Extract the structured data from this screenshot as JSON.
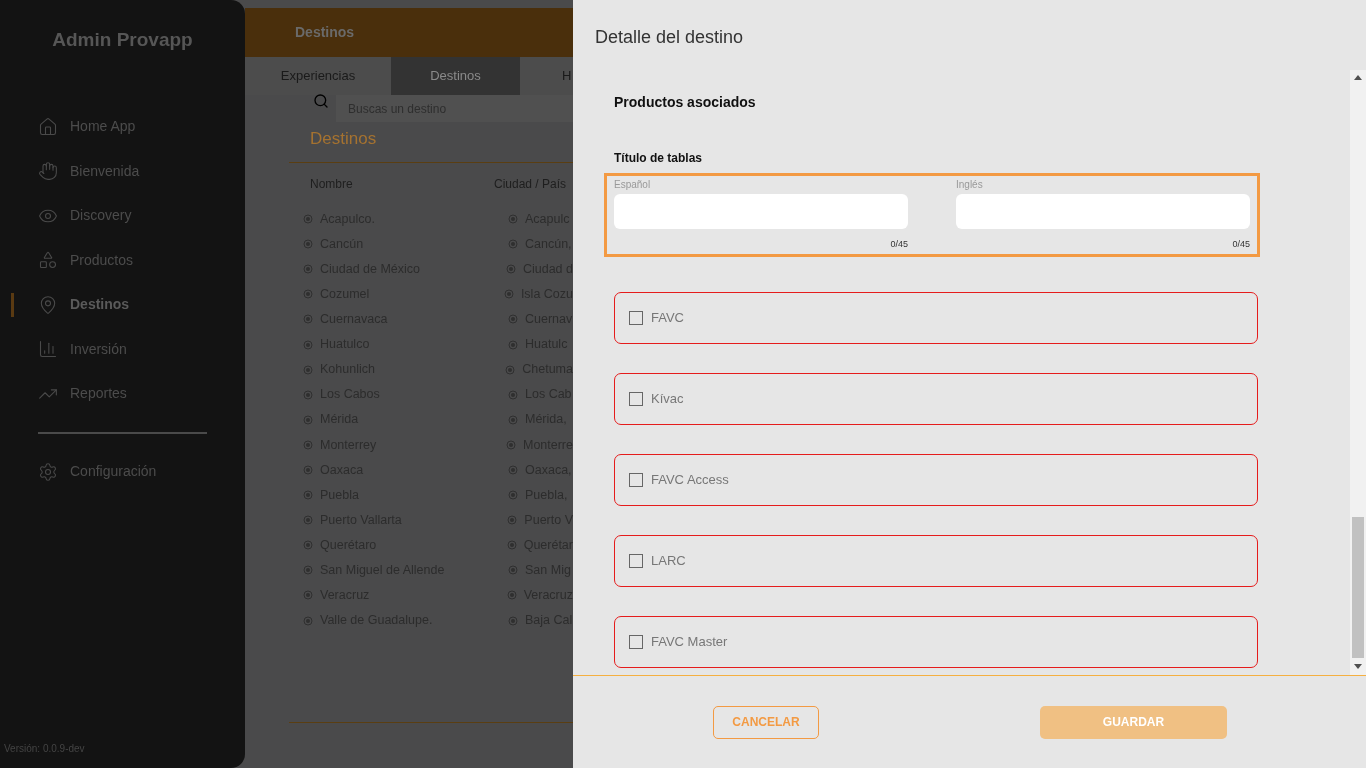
{
  "sidebar": {
    "title": "Admin Provapp",
    "items": [
      {
        "label": "Home App",
        "selected": false
      },
      {
        "label": "Bienvenida",
        "selected": false
      },
      {
        "label": "Discovery",
        "selected": false
      },
      {
        "label": "Productos",
        "selected": false
      },
      {
        "label": "Destinos",
        "selected": true
      },
      {
        "label": "Inversión",
        "selected": false
      },
      {
        "label": "Reportes",
        "selected": false
      }
    ],
    "footer_items": [
      {
        "label": "Configuración",
        "selected": false
      }
    ],
    "version": "Versión: 0.0.9-dev"
  },
  "header": {
    "title": "Destinos"
  },
  "tabs": [
    {
      "label": "Experiencias",
      "selected": false
    },
    {
      "label": "Destinos",
      "selected": true
    },
    {
      "label": "H",
      "selected": false
    }
  ],
  "search": {
    "placeholder": "Buscas un destino"
  },
  "list": {
    "title": "Destinos",
    "columns": [
      "Nombre",
      "Ciudad / País"
    ],
    "rows": [
      [
        "Acapulco.",
        "Acapulc"
      ],
      [
        "Cancún",
        "Cancún,"
      ],
      [
        "Ciudad de México",
        "Ciudad d"
      ],
      [
        "Cozumel",
        "Isla Cozu"
      ],
      [
        "Cuernavaca",
        "Cuernav"
      ],
      [
        "Huatulco",
        "Huatulc"
      ],
      [
        "Kohunlich",
        "Chetuma"
      ],
      [
        "Los Cabos",
        "Los Cab"
      ],
      [
        "Mérida",
        "Mérida,"
      ],
      [
        "Monterrey",
        "Monterre"
      ],
      [
        "Oaxaca",
        "Oaxaca,"
      ],
      [
        "Puebla",
        "Puebla,"
      ],
      [
        "Puerto Vallarta",
        "Puerto V"
      ],
      [
        "Querétaro",
        "Querétar"
      ],
      [
        "San Miguel de Allende",
        "San Mig"
      ],
      [
        "Veracruz",
        "Veracruz"
      ],
      [
        "Valle de Guadalupe.",
        "Baja Cal"
      ]
    ]
  },
  "drawer": {
    "title": "Detalle del destino",
    "section": "Productos asociados",
    "fields_title": "Título de tablas",
    "fields": [
      {
        "label": "Español",
        "counter": "0/45"
      },
      {
        "label": "Inglés",
        "counter": "0/45"
      }
    ],
    "products": [
      {
        "label": "FAVC",
        "checked": false
      },
      {
        "label": "Kívac",
        "checked": false
      },
      {
        "label": "FAVC Access",
        "checked": false
      },
      {
        "label": "LARC",
        "checked": false
      },
      {
        "label": "FAVC Master",
        "checked": false
      }
    ],
    "buttons": [
      {
        "label": "CANCELAR",
        "kind": "outline"
      },
      {
        "label": "GUARDAR",
        "kind": "filled"
      }
    ]
  }
}
